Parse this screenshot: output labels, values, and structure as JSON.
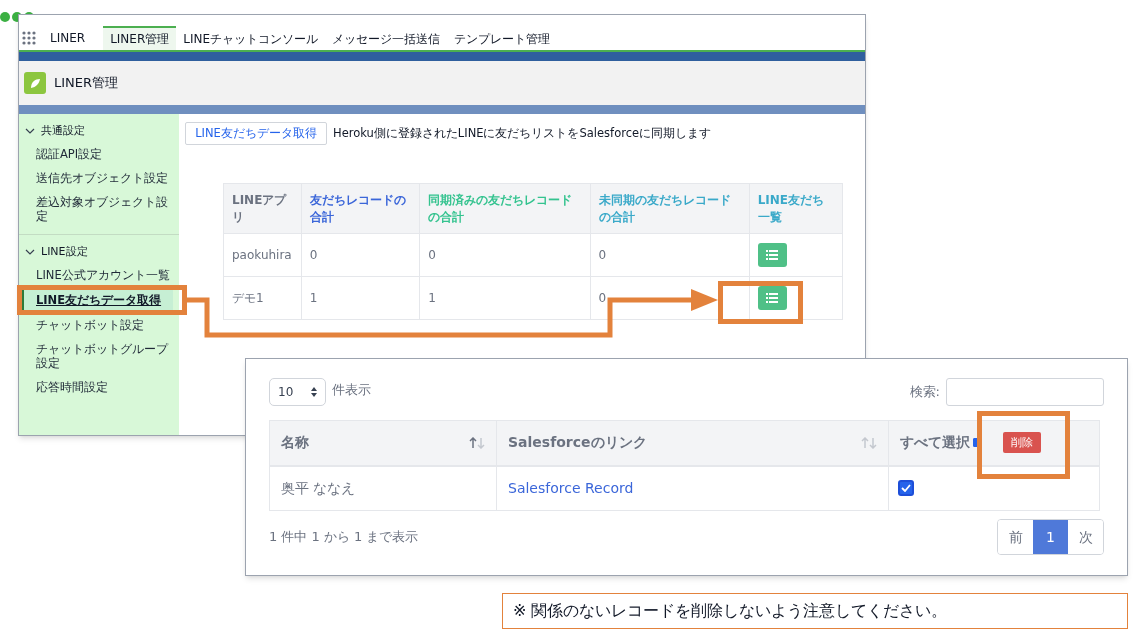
{
  "app": {
    "name": "LINER",
    "tabs": [
      {
        "label": "LINER管理",
        "selected": true
      },
      {
        "label": "LINEチャットコンソール",
        "selected": false
      },
      {
        "label": "メッセージ一括送信",
        "selected": false
      },
      {
        "label": "テンプレート管理",
        "selected": false
      }
    ]
  },
  "page_header": {
    "title": "LINER管理"
  },
  "sidebar": {
    "sections": [
      {
        "title": "共通設定",
        "expanded": true,
        "items": [
          {
            "label": "認証API設定",
            "selected": false
          },
          {
            "label": "送信先オブジェクト設定",
            "selected": false
          },
          {
            "label": "差込対象オブジェクト設定",
            "selected": false
          }
        ]
      },
      {
        "title": "LINE設定",
        "expanded": true,
        "items": [
          {
            "label": "LINE公式アカウント一覧",
            "selected": false
          },
          {
            "label": "LINE友だちデータ取得",
            "selected": true
          },
          {
            "label": "チャットボット設定",
            "selected": false
          },
          {
            "label": "チャットボットグループ設定",
            "selected": false
          },
          {
            "label": "応答時間設定",
            "selected": false
          }
        ]
      }
    ]
  },
  "sync": {
    "button": "LINE友だちデータ取得",
    "description": "Heroku側に登録されたLINEに友だちリストをSalesforceに同期します"
  },
  "summary_table": {
    "columns": [
      {
        "label": "LINEアプリ",
        "color": "#6b7280"
      },
      {
        "label": "友だちレコードの合計",
        "color": "#3b66d9"
      },
      {
        "label": "同期済みの友だちレコードの合計",
        "color": "#34c38f"
      },
      {
        "label": "未同期の友だちレコードの合計",
        "color": "#3aa9c9"
      },
      {
        "label": "LINE友だち一覧",
        "color": "#3aa9c9"
      }
    ],
    "rows": [
      {
        "cells": [
          "paokuhira",
          "0",
          "0",
          "0"
        ]
      },
      {
        "cells": [
          "デモ1",
          "1",
          "1",
          "0"
        ]
      }
    ]
  },
  "friends_dialog": {
    "page_size": "10",
    "page_size_label": "件表示",
    "search_label": "検索:",
    "columns": [
      "名称",
      "Salesforceのリンク",
      "すべて選択"
    ],
    "select_all_checked": true,
    "delete_button": "削除",
    "rows": [
      {
        "name": "奥平 ななえ",
        "link": "Salesforce Record",
        "checked": true
      }
    ],
    "info": "1 件中 1 から 1 まで表示",
    "pagination": [
      {
        "label": "前",
        "selected": false
      },
      {
        "label": "1",
        "selected": true
      },
      {
        "label": "次",
        "selected": false
      }
    ]
  },
  "note": "※ 関係のないレコードを削除しないよう注意してください。"
}
